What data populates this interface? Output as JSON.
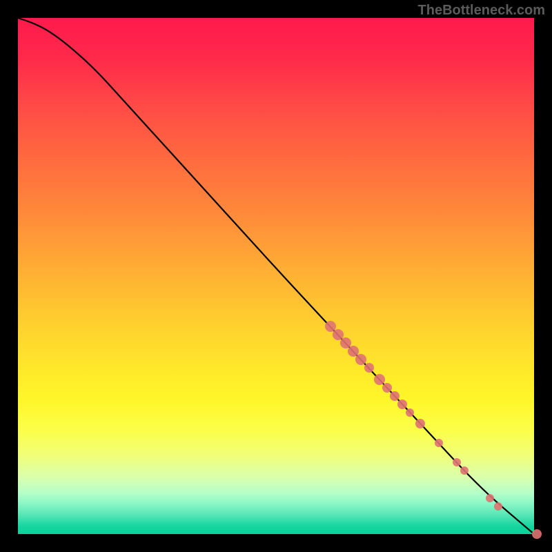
{
  "attribution": "TheBottleneck.com",
  "colors": {
    "page_bg": "#000000",
    "attribution_text": "#5b5b5b",
    "curve_stroke": "#000000",
    "marker_fill": "#e07272",
    "gradient_top": "#ff1a4d",
    "gradient_bottom": "#0cd29a"
  },
  "chart_data": {
    "type": "line",
    "title": "",
    "xlabel": "",
    "ylabel": "",
    "xlim": [
      0,
      100
    ],
    "ylim": [
      0,
      100
    ],
    "grid": false,
    "legend": false,
    "curve_xy": [
      [
        0.0,
        100.0
      ],
      [
        3.0,
        99.0
      ],
      [
        6.0,
        97.5
      ],
      [
        10.0,
        94.5
      ],
      [
        15.0,
        90.0
      ],
      [
        20.0,
        84.5
      ],
      [
        30.0,
        73.5
      ],
      [
        40.0,
        62.5
      ],
      [
        50.0,
        51.5
      ],
      [
        60.0,
        40.7
      ],
      [
        70.0,
        30.0
      ],
      [
        80.0,
        19.2
      ],
      [
        90.0,
        8.5
      ],
      [
        100.0,
        0.0
      ]
    ],
    "markers": [
      {
        "x": 60.5,
        "y": 40.2,
        "r": 8
      },
      {
        "x": 62.0,
        "y": 38.6,
        "r": 8
      },
      {
        "x": 63.5,
        "y": 37.0,
        "r": 8
      },
      {
        "x": 65.0,
        "y": 35.4,
        "r": 8
      },
      {
        "x": 66.5,
        "y": 33.8,
        "r": 8
      },
      {
        "x": 68.0,
        "y": 32.2,
        "r": 7
      },
      {
        "x": 70.0,
        "y": 30.0,
        "r": 8
      },
      {
        "x": 71.5,
        "y": 28.4,
        "r": 7
      },
      {
        "x": 73.0,
        "y": 26.8,
        "r": 7
      },
      {
        "x": 74.5,
        "y": 25.2,
        "r": 7
      },
      {
        "x": 76.0,
        "y": 23.5,
        "r": 6
      },
      {
        "x": 78.0,
        "y": 21.4,
        "r": 7
      },
      {
        "x": 81.5,
        "y": 17.6,
        "r": 6
      },
      {
        "x": 85.0,
        "y": 13.9,
        "r": 6
      },
      {
        "x": 86.5,
        "y": 12.3,
        "r": 6
      },
      {
        "x": 91.5,
        "y": 6.9,
        "r": 6
      },
      {
        "x": 93.0,
        "y": 5.4,
        "r": 6
      },
      {
        "x": 100.5,
        "y": 0.0,
        "r": 7
      }
    ]
  }
}
